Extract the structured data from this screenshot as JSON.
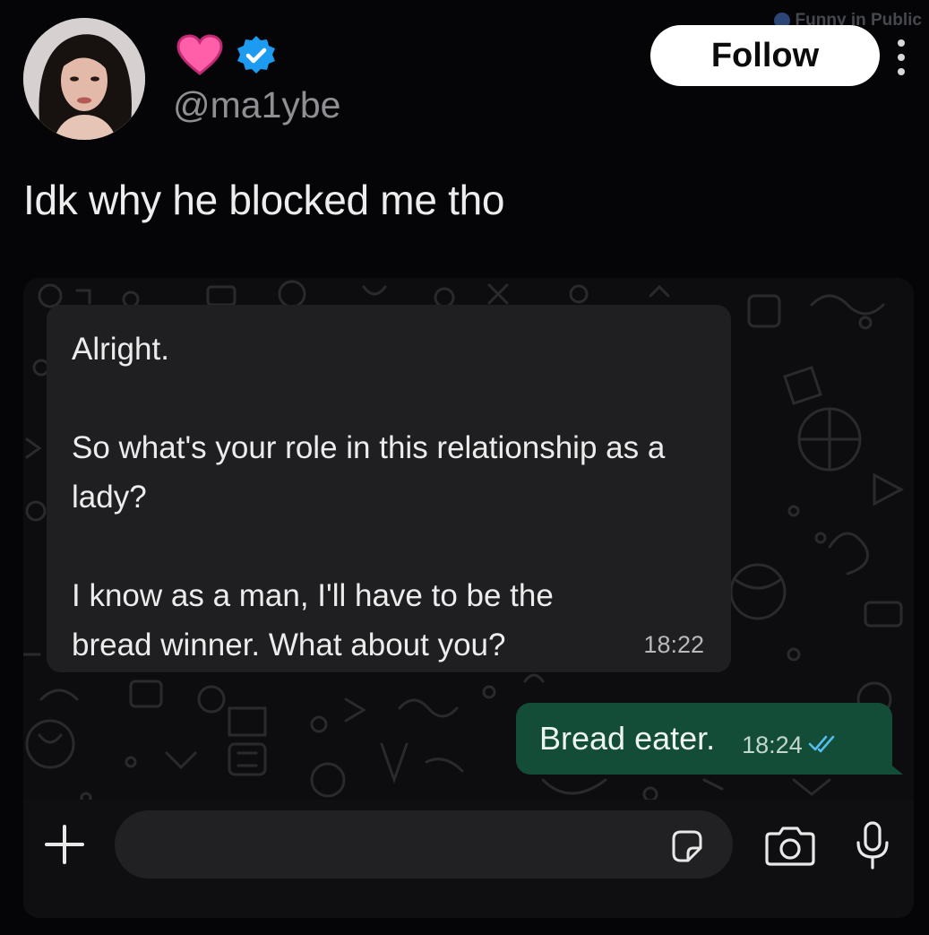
{
  "watermark": {
    "text": "Funny in Public"
  },
  "post": {
    "handle": "@ma1ybe",
    "follow_label": "Follow",
    "text": "Idk why he blocked me tho"
  },
  "chat": {
    "incoming": {
      "paragraphs": [
        "Alright.",
        "So what's your role in this relationship as a lady?",
        "I know as a man, I'll have to be the bread winner. What about you?"
      ],
      "time": "18:22"
    },
    "outgoing": {
      "text": "Bread eater.",
      "time": "18:24"
    }
  },
  "composer": {
    "value": "",
    "placeholder": ""
  },
  "colors": {
    "background": "#050507",
    "follow_button": "#ffffff",
    "outgoing_bubble": "#144d37",
    "incoming_bubble": "#1f1f21",
    "verified_badge": "#1d9bf0",
    "heart": "#ff5fa8",
    "read_ticks": "#53bdeb"
  }
}
